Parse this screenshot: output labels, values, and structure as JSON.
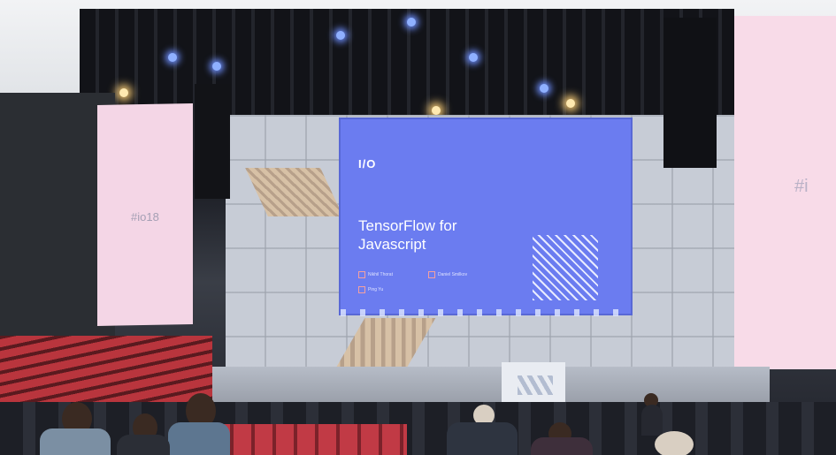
{
  "left_screen": {
    "text": "#io18"
  },
  "main_screen": {
    "logo": "I/O",
    "title": "TensorFlow for Javascript",
    "speakers": [
      "Nikhil Thorat",
      "Daniel Smilkov",
      "Ping Yu"
    ]
  },
  "right_screen": {
    "text": "#i"
  },
  "colors": {
    "main_screen": "#6b7cf0",
    "side_screens": "#f4d6e6",
    "seats": "#b9353d"
  }
}
